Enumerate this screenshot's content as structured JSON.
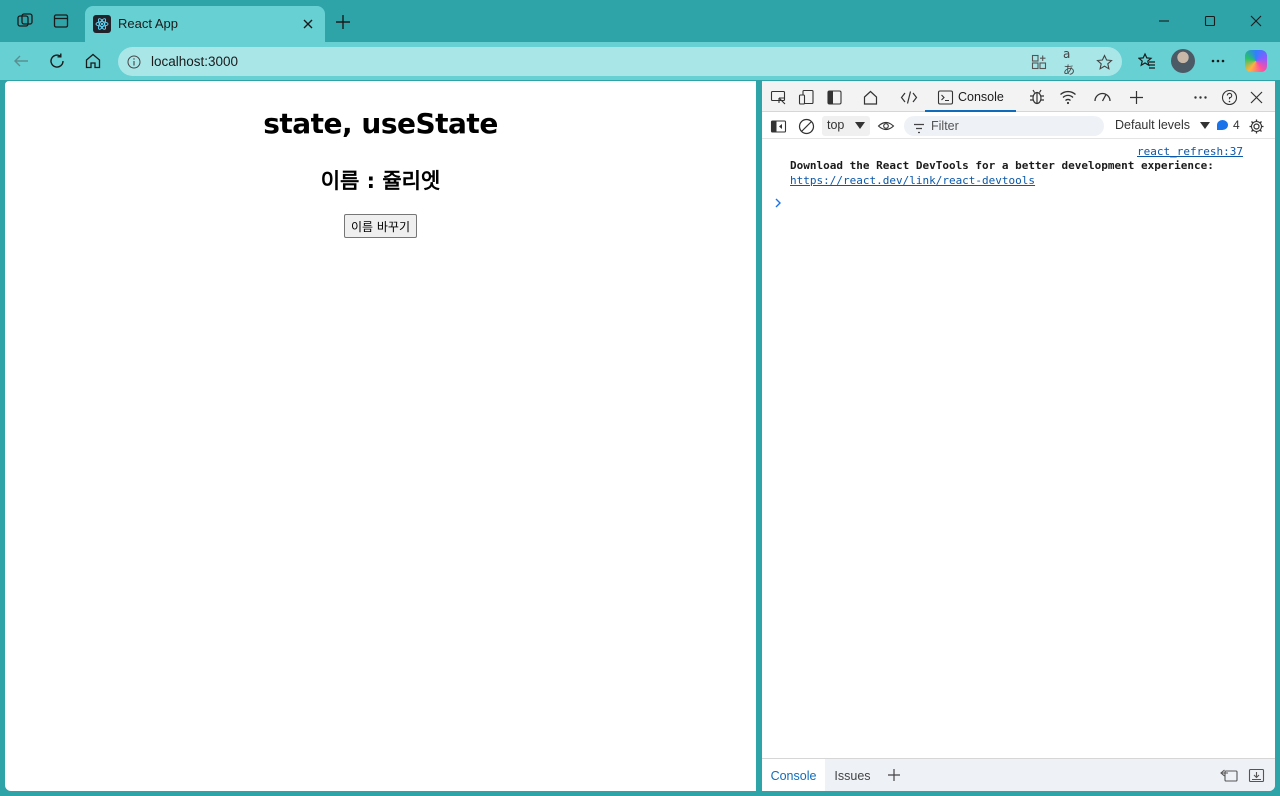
{
  "browser": {
    "tab_title": "React App",
    "address": "localhost:3000"
  },
  "page": {
    "heading": "state, useState",
    "name_line": "이름 : 쥴리엣",
    "button_label": "이름 바꾸기"
  },
  "devtools": {
    "active_tab": "Console",
    "context": "top",
    "filter_placeholder": "Filter",
    "levels": "Default levels",
    "message_count": "4",
    "log": {
      "source": "react_refresh:37",
      "message": "Download the React DevTools for a better development experience:",
      "link": "https://react.dev/link/react-devtools"
    },
    "drawer_tabs": [
      "Console",
      "Issues"
    ]
  },
  "colors": {
    "frame": "#2ea3a8",
    "toolbar": "#66d0d3",
    "address_bg": "#a9e6e8",
    "accent": "#0f6cbd"
  }
}
